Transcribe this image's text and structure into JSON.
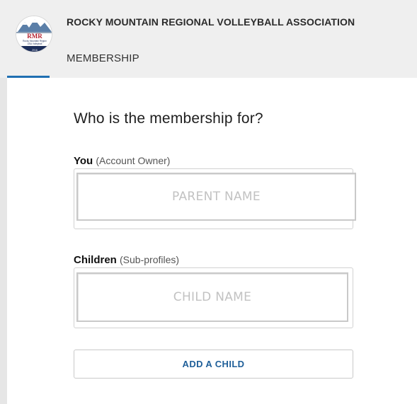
{
  "header": {
    "logo": {
      "icon": "rmr-logo-icon",
      "initials": "RMR",
      "line1": "Rocky Mountain Region",
      "line2": "USA Volleyball",
      "year": "2016"
    },
    "org_name": "ROCKY MOUNTAIN REGIONAL VOLLEYBALL ASSOCIATION",
    "section": "MEMBERSHIP",
    "accent_color": "#1f6fb2"
  },
  "main": {
    "question": "Who is the membership for?",
    "you": {
      "label": "You",
      "sublabel": "(Account Owner)",
      "value": "PARENT NAME"
    },
    "children": {
      "label": "Children",
      "sublabel": "(Sub-profiles)",
      "value": "CHILD NAME"
    },
    "add_child_label": "ADD A CHILD",
    "button_text_color": "#1f5f99"
  }
}
